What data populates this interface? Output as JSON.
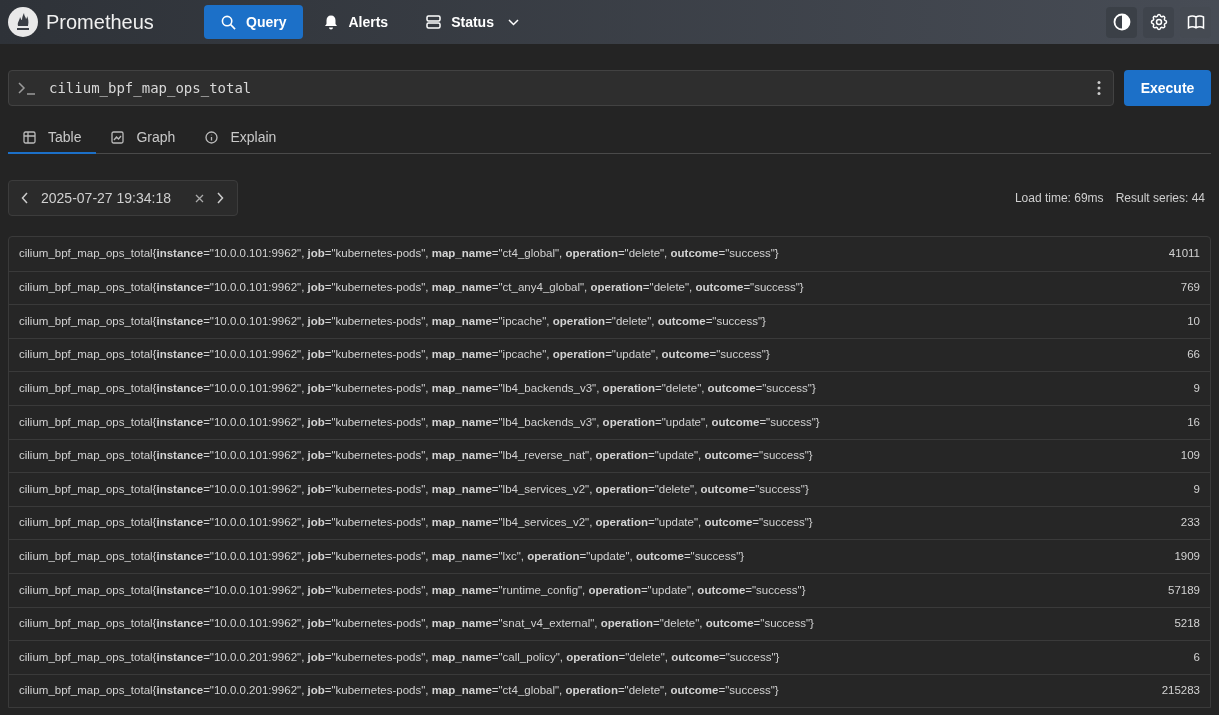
{
  "header": {
    "brand": "Prometheus",
    "nav": [
      {
        "label": "Query",
        "selected": true
      },
      {
        "label": "Alerts",
        "selected": false
      },
      {
        "label": "Status",
        "selected": false
      }
    ]
  },
  "query": {
    "value": "cilium_bpf_map_ops_total",
    "execute": "Execute"
  },
  "tabs": [
    {
      "label": "Table",
      "selected": true
    },
    {
      "label": "Graph",
      "selected": false
    },
    {
      "label": "Explain",
      "selected": false
    }
  ],
  "time": {
    "value": "2025-07-27 19:34:18"
  },
  "stats": [
    "Load time: 69ms",
    "Result series: 44"
  ],
  "rows": [
    {
      "series": "cilium_bpf_map_ops_total{**instance**=\"10.0.0.101:9962\", **job**=\"kubernetes-pods\", **map_name**=\"ct4_global\", **operation**=\"delete\", **outcome**=\"success\"}",
      "value": "41011"
    },
    {
      "series": "cilium_bpf_map_ops_total{**instance**=\"10.0.0.101:9962\", **job**=\"kubernetes-pods\", **map_name**=\"ct_any4_global\", **operation**=\"delete\", **outcome**=\"success\"}",
      "value": "769"
    },
    {
      "series": "cilium_bpf_map_ops_total{**instance**=\"10.0.0.101:9962\", **job**=\"kubernetes-pods\", **map_name**=\"ipcache\", **operation**=\"delete\", **outcome**=\"success\"}",
      "value": "10"
    },
    {
      "series": "cilium_bpf_map_ops_total{**instance**=\"10.0.0.101:9962\", **job**=\"kubernetes-pods\", **map_name**=\"ipcache\", **operation**=\"update\", **outcome**=\"success\"}",
      "value": "66"
    },
    {
      "series": "cilium_bpf_map_ops_total{**instance**=\"10.0.0.101:9962\", **job**=\"kubernetes-pods\", **map_name**=\"lb4_backends_v3\", **operation**=\"delete\", **outcome**=\"success\"}",
      "value": "9"
    },
    {
      "series": "cilium_bpf_map_ops_total{**instance**=\"10.0.0.101:9962\", **job**=\"kubernetes-pods\", **map_name**=\"lb4_backends_v3\", **operation**=\"update\", **outcome**=\"success\"}",
      "value": "16"
    },
    {
      "series": "cilium_bpf_map_ops_total{**instance**=\"10.0.0.101:9962\", **job**=\"kubernetes-pods\", **map_name**=\"lb4_reverse_nat\", **operation**=\"update\", **outcome**=\"success\"}",
      "value": "109"
    },
    {
      "series": "cilium_bpf_map_ops_total{**instance**=\"10.0.0.101:9962\", **job**=\"kubernetes-pods\", **map_name**=\"lb4_services_v2\", **operation**=\"delete\", **outcome**=\"success\"}",
      "value": "9"
    },
    {
      "series": "cilium_bpf_map_ops_total{**instance**=\"10.0.0.101:9962\", **job**=\"kubernetes-pods\", **map_name**=\"lb4_services_v2\", **operation**=\"update\", **outcome**=\"success\"}",
      "value": "233"
    },
    {
      "series": "cilium_bpf_map_ops_total{**instance**=\"10.0.0.101:9962\", **job**=\"kubernetes-pods\", **map_name**=\"lxc\", **operation**=\"update\", **outcome**=\"success\"}",
      "value": "1909"
    },
    {
      "series": "cilium_bpf_map_ops_total{**instance**=\"10.0.0.101:9962\", **job**=\"kubernetes-pods\", **map_name**=\"runtime_config\", **operation**=\"update\", **outcome**=\"success\"}",
      "value": "57189"
    },
    {
      "series": "cilium_bpf_map_ops_total{**instance**=\"10.0.0.101:9962\", **job**=\"kubernetes-pods\", **map_name**=\"snat_v4_external\", **operation**=\"delete\", **outcome**=\"success\"}",
      "value": "5218"
    },
    {
      "series": "cilium_bpf_map_ops_total{**instance**=\"10.0.0.201:9962\", **job**=\"kubernetes-pods\", **map_name**=\"call_policy\", **operation**=\"delete\", **outcome**=\"success\"}",
      "value": "6"
    },
    {
      "series": "cilium_bpf_map_ops_total{**instance**=\"10.0.0.201:9962\", **job**=\"kubernetes-pods\", **map_name**=\"ct4_global\", **operation**=\"delete\", **outcome**=\"success\"}",
      "value": "215283"
    }
  ]
}
